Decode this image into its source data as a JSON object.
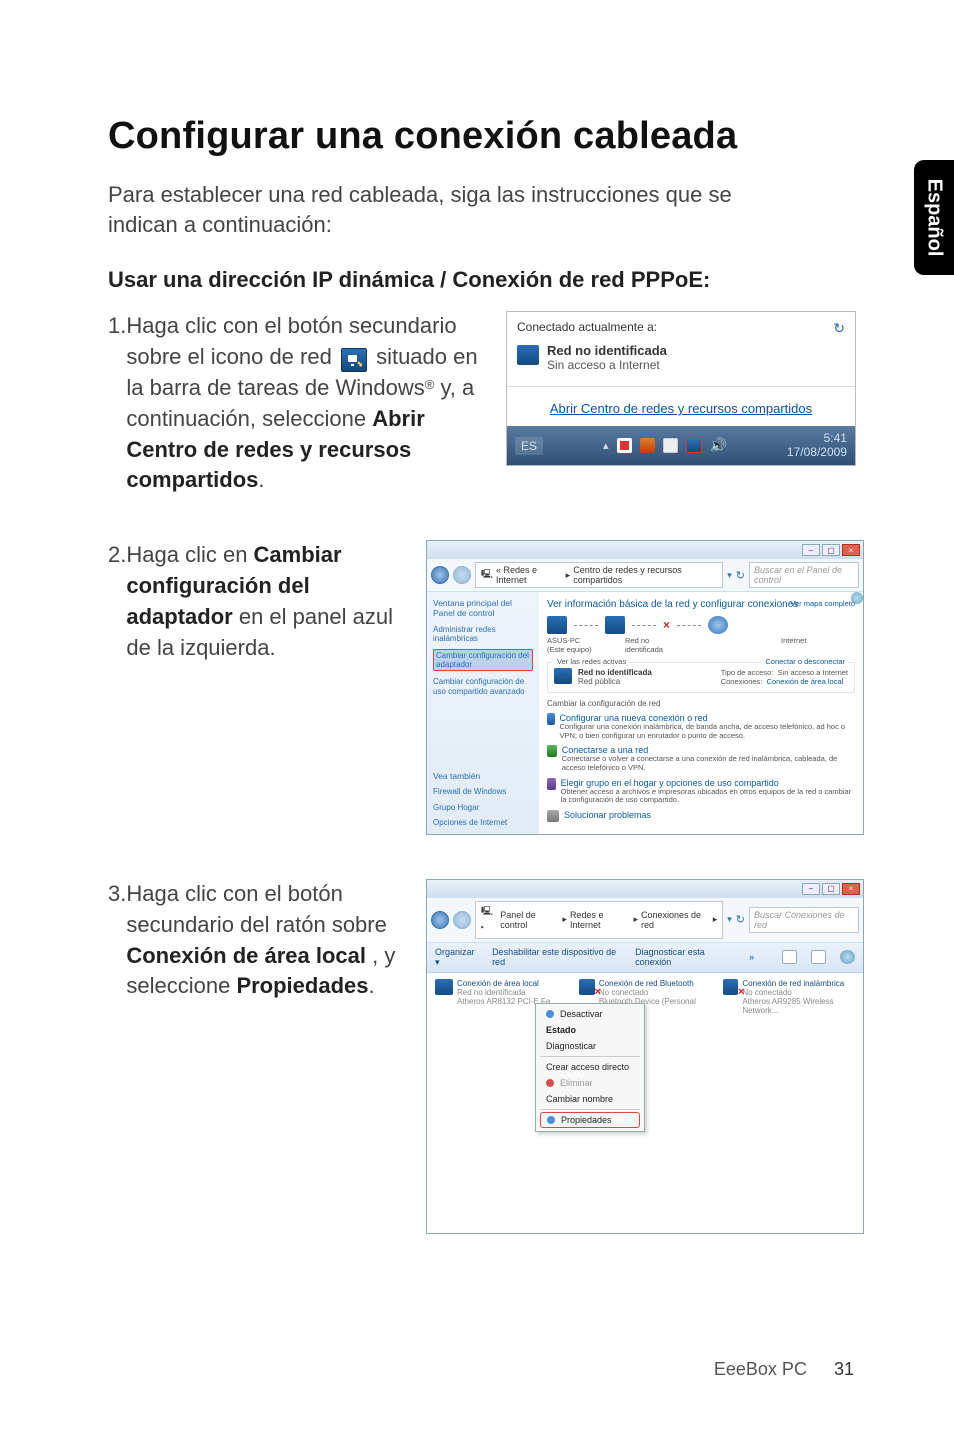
{
  "side_tab": "Español",
  "h1": "Configurar una conexión cableada",
  "intro": "Para establecer una red cableada, siga las instrucciones que se indican a continuación:",
  "h2": "Usar una dirección IP dinámica / Conexión de red PPPoE:",
  "step1": {
    "num": "1.",
    "t1": "Haga clic con el botón secundario sobre el icono de red ",
    "t2": " situado en la barra de tareas de Windows",
    "reg": "®",
    "t3": " y, a continuación, seleccione ",
    "b": "Abrir Centro de redes y recursos compartidos",
    "dot": "."
  },
  "step2": {
    "num": "2.",
    "t1": "Haga clic en ",
    "b": "Cambiar configuración del adaptador",
    "t2": " en el panel azul de la izquierda."
  },
  "step3": {
    "num": "3.",
    "t1": "Haga clic con el botón secundario del ratón sobre ",
    "b1": "Conexión de área local",
    "t2": ", y seleccione ",
    "b2": "Propiedades",
    "dot": "."
  },
  "fig1": {
    "connected": "Conectado actualmente a:",
    "net_name": "Red no identificada",
    "net_sub": "Sin acceso a Internet",
    "link": "Abrir Centro de redes y recursos compartidos",
    "lang": "ES",
    "time": "5:41",
    "date": "17/08/2009"
  },
  "fig2": {
    "crumb1": "« Redes e Internet",
    "crumb2": "Centro de redes y recursos compartidos",
    "search_ph": "Buscar en el Panel de control",
    "side_home": "Ventana principal del Panel de control",
    "side_wifi": "Administrar redes inalámbricas",
    "side_adapter": "Cambiar configuración del adaptador",
    "side_adv": "Cambiar configuración de uso compartido avanzado",
    "see": "Vea también",
    "see1": "Firewall de Windows",
    "see2": "Grupo Hogar",
    "see3": "Opciones de Internet",
    "title": "Ver información básica de la red y configurar conexiones",
    "mapfull": "Ver mapa completo",
    "pc": "ASUS-PC",
    "pc_sub": "(Este equipo)",
    "netu": "Red no identificada",
    "inet": "Internet",
    "grp_active": "Ver las redes activas",
    "grp_connect": "Conectar o desconectar",
    "netname_b": "Red no identificada",
    "netname_s": "Red pública",
    "kv_type": "Tipo de acceso:",
    "kv_type_v": "Sin acceso a Internet",
    "kv_conn": "Conexiones:",
    "kv_conn_v": "Conexión de área local",
    "subt": "Cambiar la configuración de red",
    "i1a": "Configurar una nueva conexión o red",
    "i1d": "Configurar una conexión inalámbrica, de banda ancha, de acceso telefónico, ad hoc o VPN; o bien configurar un enrutador o punto de acceso.",
    "i2a": "Conectarse a una red",
    "i2d": "Conectarse o volver a conectarse a una conexión de red inalámbrica, cableada, de acceso telefónico o VPN.",
    "i3a": "Elegir grupo en el hogar y opciones de uso compartido",
    "i3d": "Obtener acceso a archivos e impresoras ubicados en otros equipos de la red o cambiar la configuración de uso compartido.",
    "i4a": "Solucionar problemas"
  },
  "fig3": {
    "crumb1": "Panel de control",
    "crumb2": "Redes e Internet",
    "crumb3": "Conexiones de red",
    "search_ph": "Buscar Conexiones de red",
    "tb_org": "Organizar ▾",
    "tb_dis": "Deshabilitar este dispositivo de red",
    "tb_diag": "Diagnosticar esta conexión",
    "c1_t": "Conexión de área local",
    "c1_s": "Red no identificada",
    "c1_d": "Atheros AR8132 PCI-E Fa...",
    "c2_t": "Conexión de red Bluetooth",
    "c2_s": "No conectado",
    "c2_d": "Bluetooth Device (Personal Area ...",
    "c3_t": "Conexión de red inalámbrica",
    "c3_s": "No conectado",
    "c3_d": "Atheros AR9285 Wireless Network...",
    "m_desactivar": "Desactivar",
    "m_estado": "Estado",
    "m_diag": "Diagnosticar",
    "m_crear": "Crear acceso directo",
    "m_elim": "Eliminar",
    "m_renom": "Cambiar nombre",
    "m_prop": "Propiedades"
  },
  "footer_product": "EeeBox PC",
  "footer_page": "31"
}
